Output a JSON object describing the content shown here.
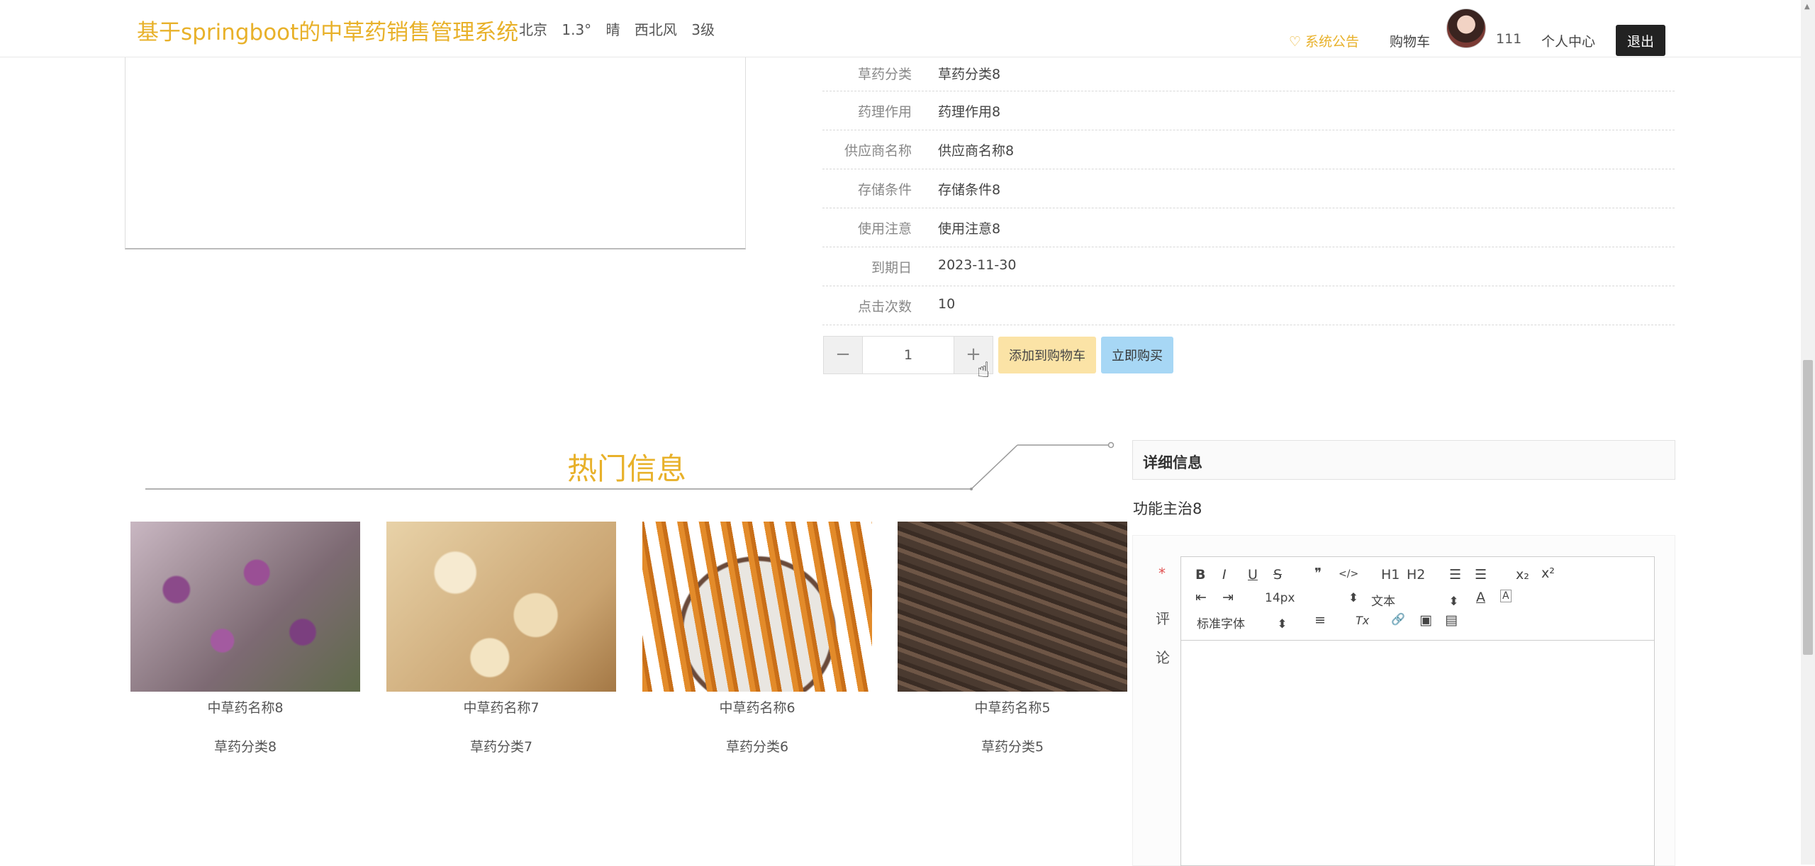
{
  "header": {
    "site_title": "基于springboot的中草药销售管理系统",
    "weather": {
      "city": "北京",
      "temp": "1.3°",
      "condition": "晴",
      "wind_dir": "西北风",
      "wind_level": "3级"
    },
    "notice_label": "系统公告",
    "cart_label": "购物车",
    "username": "111",
    "profile_label": "个人中心",
    "logout_label": "退出"
  },
  "detail": {
    "rows": [
      {
        "label": "草药分类",
        "value": "草药分类8"
      },
      {
        "label": "药理作用",
        "value": "药理作用8"
      },
      {
        "label": "供应商名称",
        "value": "供应商名称8"
      },
      {
        "label": "存储条件",
        "value": "存储条件8"
      },
      {
        "label": "使用注意",
        "value": "使用注意8"
      },
      {
        "label": "到期日",
        "value": "2023-11-30"
      },
      {
        "label": "点击次数",
        "value": "10"
      }
    ]
  },
  "purchase": {
    "minus": "−",
    "quantity": "1",
    "plus": "+",
    "add_cart_label": "添加到购物车",
    "buy_now_label": "立即购买"
  },
  "hot": {
    "title": "热门信息",
    "items": [
      {
        "name": "中草药名称8",
        "category": "草药分类8"
      },
      {
        "name": "中草药名称7",
        "category": "草药分类7"
      },
      {
        "name": "中草药名称6",
        "category": "草药分类6"
      },
      {
        "name": "中草药名称5",
        "category": "草药分类5"
      }
    ]
  },
  "info": {
    "header": "详细信息",
    "function_text": "功能主治8",
    "required_mark": "*",
    "comment_label": "评论",
    "toolbar": {
      "bold": "B",
      "italic": "I",
      "underline": "U",
      "strike": "S",
      "quote": "❞",
      "code": "</>",
      "h1": "H1",
      "h2": "H2",
      "ol": "☰",
      "ul": "☰",
      "sub": "x₂",
      "sup": "x²",
      "outdent": "⇤",
      "indent": "⇥",
      "font_size": "14px",
      "header_select": "文本",
      "font_family": "标准字体",
      "color": "A",
      "background": "A",
      "align": "≡",
      "clean": "Tx",
      "link": "🔗",
      "image": "▣",
      "video": "▤"
    }
  }
}
